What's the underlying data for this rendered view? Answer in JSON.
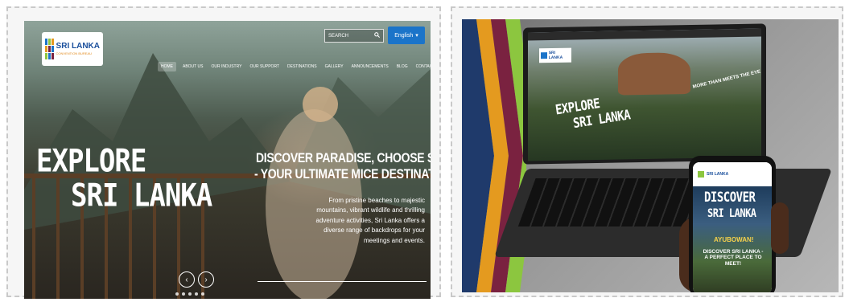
{
  "left_site": {
    "logo": {
      "title": "SRI LANKA",
      "subtitle": "CONVENTION BUREAU"
    },
    "search": {
      "placeholder": "SEARCH",
      "icon": "search-icon"
    },
    "language": {
      "label": "English"
    },
    "nav": [
      "HOME",
      "ABOUT US",
      "OUR INDUSTRY",
      "OUR SUPPORT",
      "DESTINATIONS",
      "GALLERY",
      "ANNOUNCEMENTS",
      "BLOG",
      "CONTACT US"
    ],
    "hero": {
      "line1": "EXPLORE",
      "line2": "SRI LANKA"
    },
    "discover": {
      "line1": "DISCOVER PARADISE, CHOOSE SRI LANKA",
      "line2": "- YOUR ULTIMATE MICE DESTINATION!",
      "paragraph": "From pristine beaches to majestic mountains, vibrant wildlife and thrilling adventure activities, Sri Lanka offers a diverse range of backdrops for your meetings and events."
    },
    "arrows": {
      "prev": "‹",
      "next": "›"
    }
  },
  "right_mockup": {
    "laptop": {
      "logo": "SRI LANKA",
      "hero1": "EXPLORE",
      "hero2": "SRI LANKA",
      "tagline": "MORE THAN MEETS THE EYE"
    },
    "phone": {
      "logo": "SRI LANKA",
      "hero1": "DISCOVER",
      "hero2": "SRI LANKA",
      "greeting": "AYUBOWAN!",
      "tagline": "DISCOVER SRI LANKA - A PERFECT PLACE TO MEET!"
    }
  },
  "colors": {
    "accent_blue": "#1b74c9",
    "stripe_orange": "#e49a1f",
    "stripe_maroon": "#7a2240",
    "stripe_green": "#8cc63f",
    "stripe_navy": "#1f3a6b"
  }
}
